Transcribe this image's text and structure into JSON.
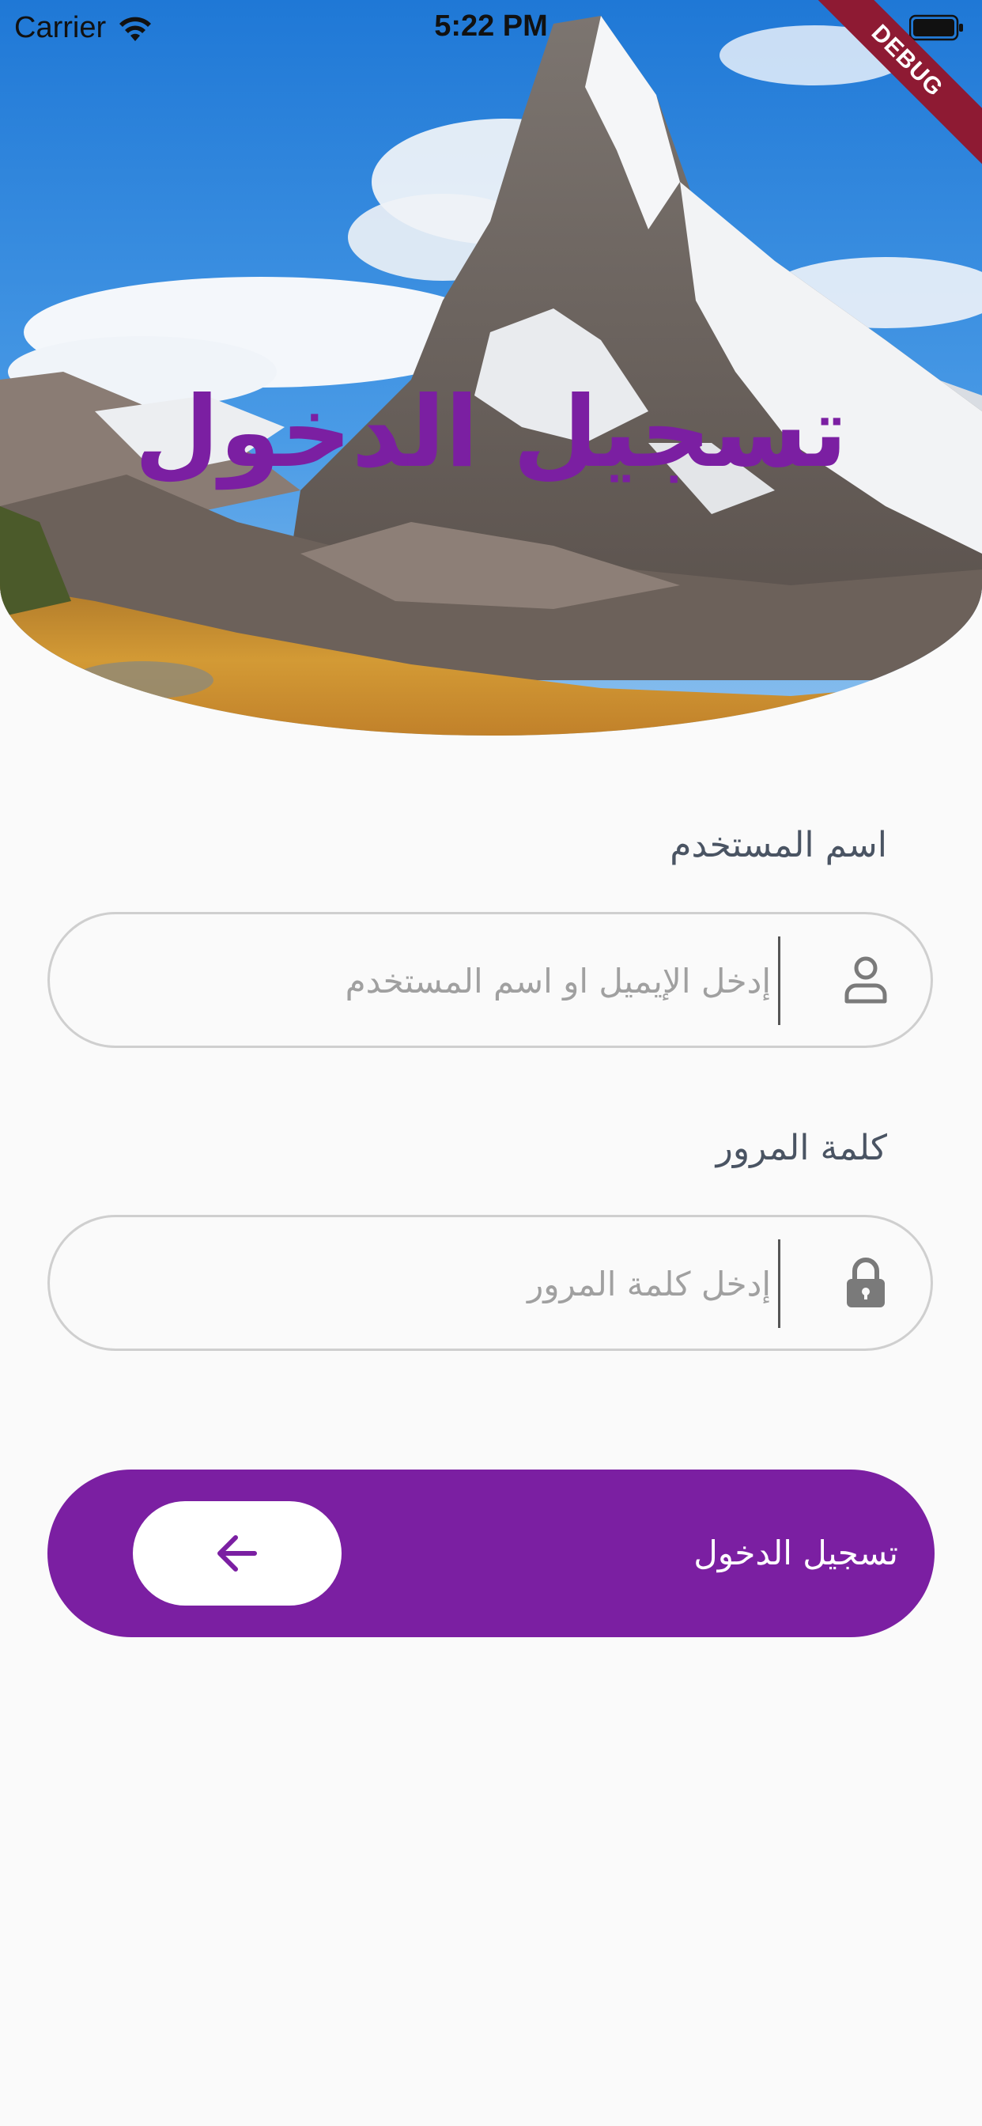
{
  "status_bar": {
    "carrier": "Carrier",
    "time": "5:22 PM",
    "debug_label": "DEBUG"
  },
  "header": {
    "title": "تسجيل الدخول",
    "image": "mountain-landscape"
  },
  "form": {
    "username": {
      "label": "اسم المستخدم",
      "placeholder": "إدخل الإيميل او اسم المستخدم",
      "value": "",
      "icon": "user-icon"
    },
    "password": {
      "label": "كلمة المرور",
      "placeholder": "إدخل كلمة المرور",
      "value": "",
      "icon": "lock-icon"
    },
    "login_button": {
      "label": "تسجيل الدخول",
      "icon": "arrow-left-icon"
    }
  },
  "colors": {
    "accent": "#7b1fa2",
    "background": "#fafafa",
    "label": "#4a5463",
    "placeholder": "#a0a0a0",
    "border": "#cfcfcf"
  }
}
